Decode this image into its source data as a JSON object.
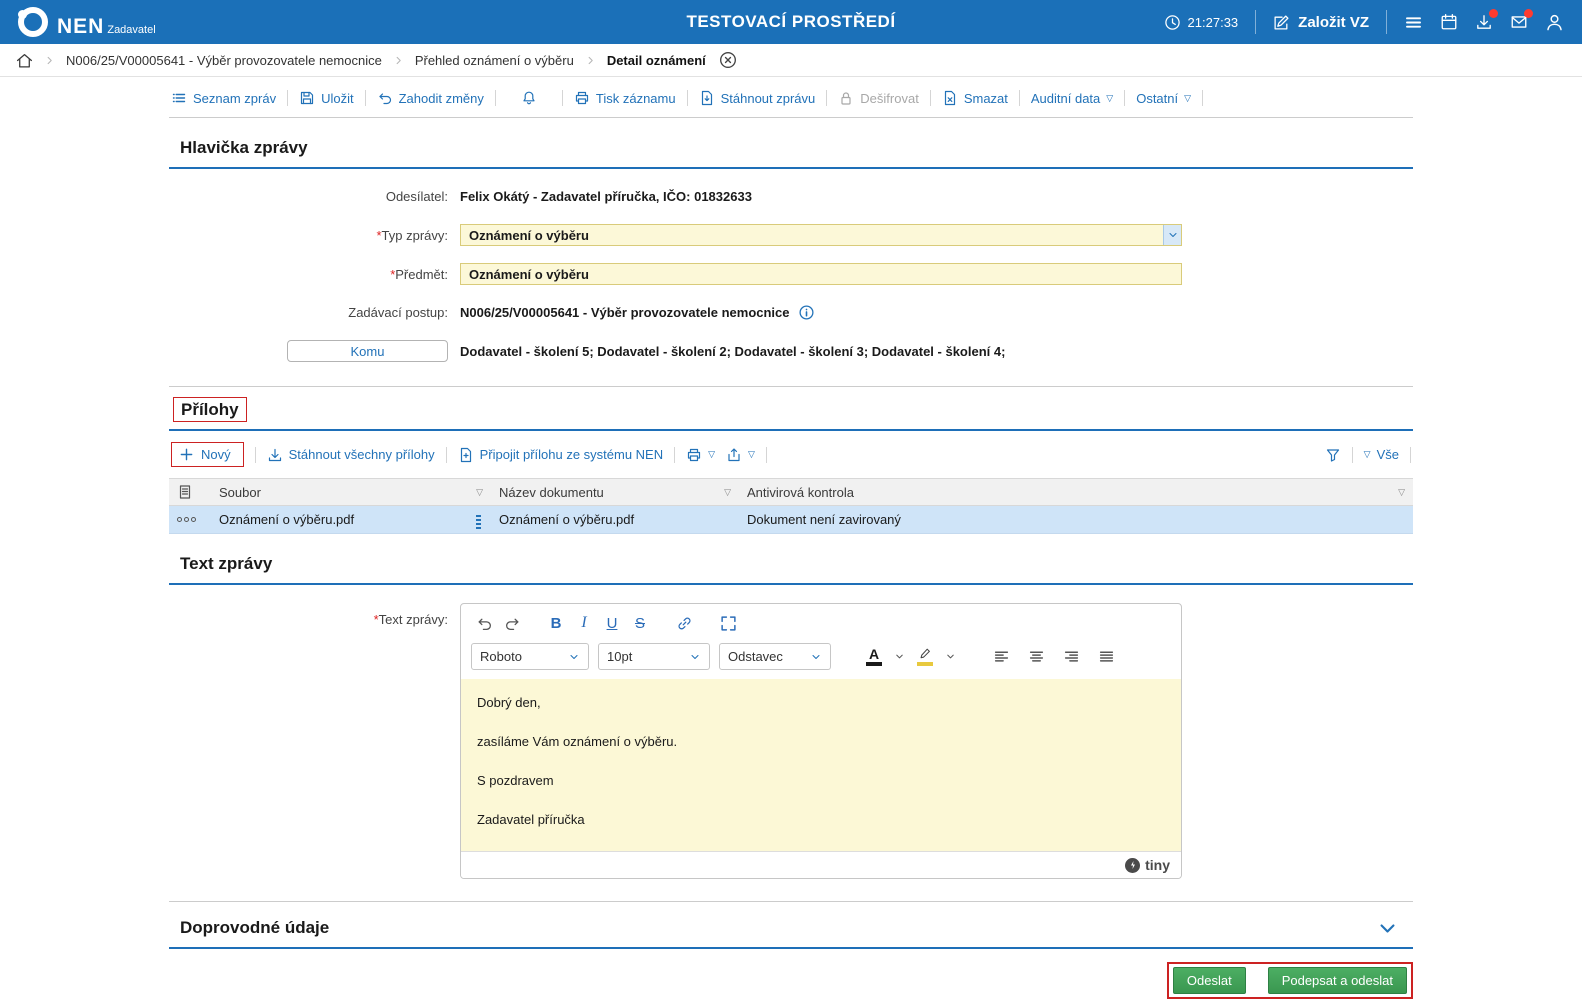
{
  "colors": {
    "header_blue": "#1b70b8",
    "accent_blue": "#2272b8",
    "section_underline": "#1e6fb8",
    "field_yellow": "#fcf8d8",
    "editor_yellow": "#fcf8d6",
    "selected_row_blue": "#cfe4f8",
    "button_green": "#3fa05a",
    "highlight_red": "#cc2222",
    "badge_red": "#ff3b30"
  },
  "required_marker": "*",
  "icons": {
    "caret_down": "▽",
    "bold": "B",
    "italic": "I",
    "underline": "U",
    "strikethrough": "S",
    "color_letter": "A"
  },
  "header": {
    "logo": "NEN",
    "logo_sub": "Zadavatel",
    "title": "TESTOVACÍ PROSTŘEDÍ",
    "time": "21:27:33",
    "new_vz": "Založit VZ"
  },
  "breadcrumb": {
    "items": [
      "N006/25/V00005641 - Výběr provozovatele nemocnice",
      "Přehled oznámení o výběru",
      "Detail oznámení"
    ]
  },
  "commands": {
    "seznam": "Seznam zpráv",
    "ulozit": "Uložit",
    "zahodit": "Zahodit změny",
    "tisk": "Tisk záznamu",
    "stahnout": "Stáhnout zprávu",
    "desifrovat": "Dešifrovat",
    "smazat": "Smazat",
    "auditni": "Auditní data",
    "ostatni": "Ostatní"
  },
  "message": {
    "title": "Hlavička zprávy",
    "sender_label": "Odesílatel:",
    "sender_value": "Felix Okátý - Zadavatel příručka, IČO: 01832633",
    "type_label": "Typ zprávy:",
    "type_value": "Oznámení o výběru",
    "subject_label": "Předmět:",
    "subject_value": "Oznámení o výběru",
    "procedure_label": "Zadávací postup:",
    "procedure_value": "N006/25/V00005641 - Výběr provozovatele nemocnice",
    "to_button": "Komu",
    "to_value": "Dodavatel - školení 5; Dodavatel - školení 2; Dodavatel - školení 3; Dodavatel - školení 4;"
  },
  "attachments": {
    "title": "Přílohy",
    "new": "Nový",
    "download_all": "Stáhnout všechny přílohy",
    "attach_nen": "Připojit přílohu ze systému NEN",
    "all_filter": "Vše",
    "columns": [
      "Soubor",
      "Název dokumentu",
      "Antivirová kontrola"
    ],
    "row": {
      "file": "Oznámení o výběru.pdf",
      "doc_name": "Oznámení o výběru.pdf",
      "antivirus": "Dokument není zavirovaný"
    }
  },
  "text_message": {
    "title": "Text zprávy",
    "label": "Text zprávy:",
    "editor": {
      "font": "Roboto",
      "size": "10pt",
      "block": "Odstavec",
      "brand": "tiny"
    },
    "lines": [
      "Dobrý den,",
      "zasíláme Vám oznámení o výběru.",
      "S pozdravem",
      "Zadavatel příručka"
    ]
  },
  "accompanying": {
    "title": "Doprovodné údaje"
  },
  "actions": {
    "send": "Odeslat",
    "sign_send": "Podepsat a odeslat"
  }
}
